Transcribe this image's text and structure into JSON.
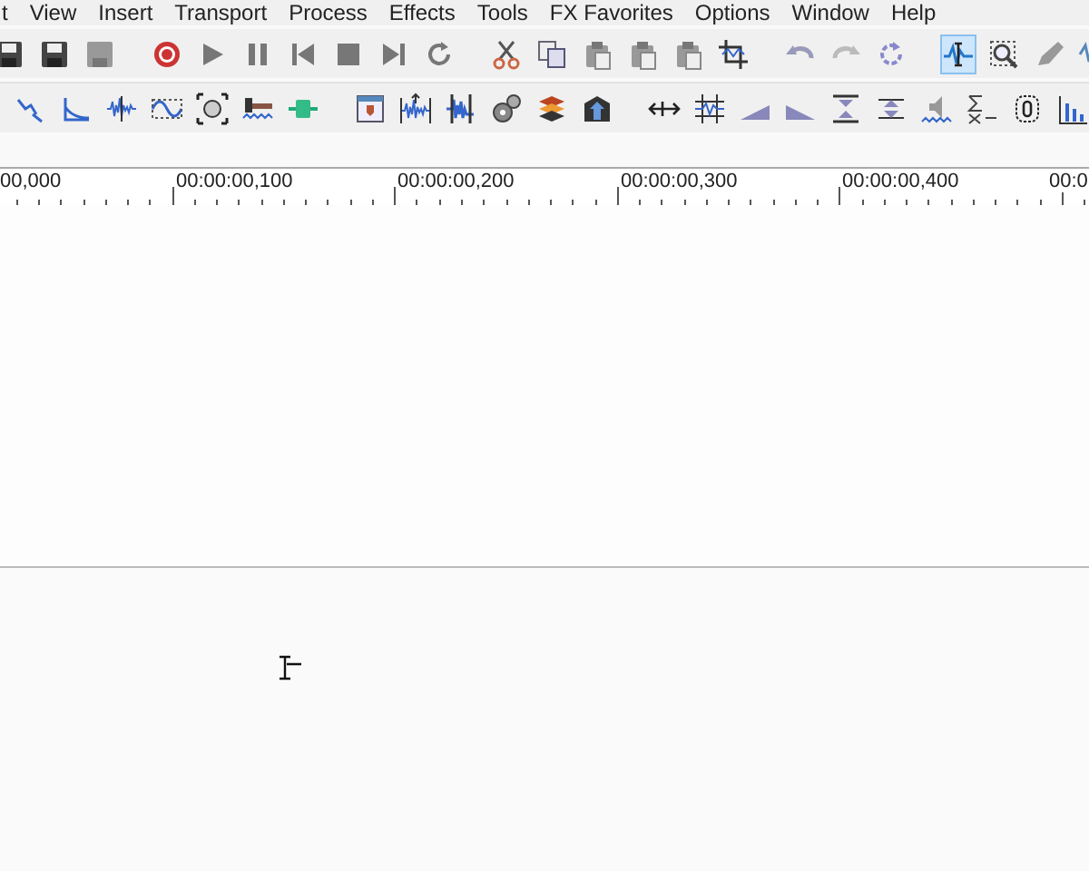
{
  "menu_bar": [
    "t",
    "View",
    "Insert",
    "Transport",
    "Process",
    "Effects",
    "Tools",
    "FX Favorites",
    "Options",
    "Window",
    "Help"
  ],
  "edit_tools": [
    {
      "selected": true
    },
    {
      "selected": false
    },
    {
      "selected": false
    },
    {
      "selected": false
    }
  ],
  "time_ruler": {
    "labels": [
      "00,000",
      "00:00:00,100",
      "00:00:00,200",
      "00:00:00,300",
      "00:00:00,400",
      "00:0"
    ]
  }
}
